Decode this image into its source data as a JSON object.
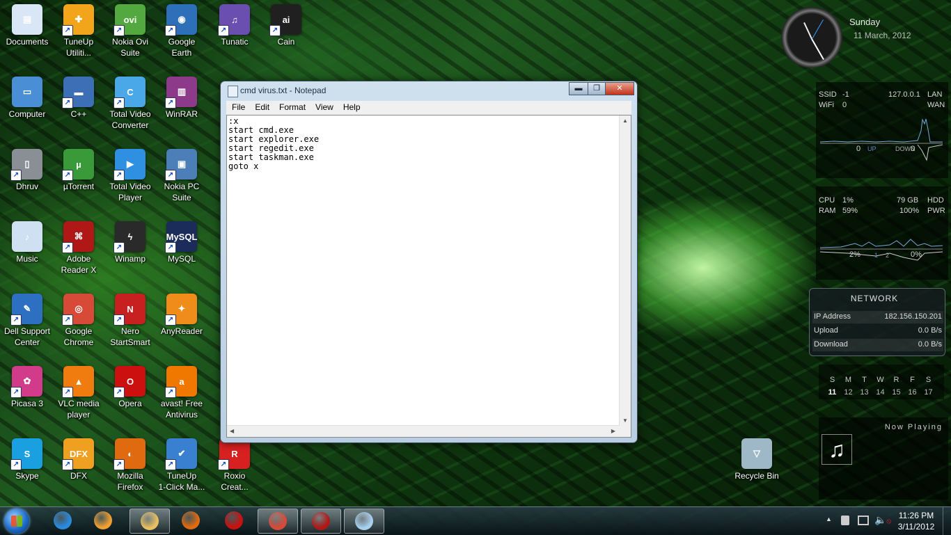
{
  "desktop_icons": [
    {
      "label": "Documents",
      "color": "#d9e6f5",
      "glyph": "▤",
      "shortcut": false
    },
    {
      "label": "TuneUp\nUtiliti...",
      "color": "#f2a51a",
      "glyph": "✚",
      "shortcut": true
    },
    {
      "label": "Nokia Ovi\nSuite",
      "color": "#53a93f",
      "glyph": "ovi",
      "shortcut": true
    },
    {
      "label": "Google\nEarth",
      "color": "#2d6fb8",
      "glyph": "◉",
      "shortcut": true
    },
    {
      "label": "Tunatic",
      "color": "#6a4fb0",
      "glyph": "♫",
      "shortcut": true
    },
    {
      "label": "Cain",
      "color": "#202020",
      "glyph": "ai",
      "shortcut": true
    },
    {
      "label": "Computer",
      "color": "#4a8fd6",
      "glyph": "▭",
      "shortcut": false
    },
    {
      "label": "C++",
      "color": "#3c6fb5",
      "glyph": "▬",
      "shortcut": true
    },
    {
      "label": "Total Video\nConverter",
      "color": "#4aa8e8",
      "glyph": "C",
      "shortcut": true
    },
    {
      "label": "WinRAR",
      "color": "#8e3a8a",
      "glyph": "▥",
      "shortcut": true
    },
    {
      "label": "Dhruv",
      "color": "#8a8f96",
      "glyph": "▯",
      "shortcut": true
    },
    {
      "label": "µTorrent",
      "color": "#3a9a3a",
      "glyph": "µ",
      "shortcut": true
    },
    {
      "label": "Total Video\nPlayer",
      "color": "#2f8fe0",
      "glyph": "▶",
      "shortcut": true
    },
    {
      "label": "Nokia PC\nSuite",
      "color": "#4c7fb8",
      "glyph": "▣",
      "shortcut": true
    },
    {
      "label": "Music",
      "color": "#cfe0f2",
      "glyph": "♪",
      "shortcut": false
    },
    {
      "label": "Adobe\nReader X",
      "color": "#b01818",
      "glyph": "⌘",
      "shortcut": true
    },
    {
      "label": "Winamp",
      "color": "#2a2a2a",
      "glyph": "ϟ",
      "shortcut": true
    },
    {
      "label": "MySQL",
      "color": "#1c2c5a",
      "glyph": "MySQL",
      "shortcut": true
    },
    {
      "label": "Dell Support\nCenter",
      "color": "#2d6fc0",
      "glyph": "✎",
      "shortcut": true
    },
    {
      "label": "Google\nChrome",
      "color": "#d84a38",
      "glyph": "◎",
      "shortcut": true
    },
    {
      "label": "Nero\nStartSmart",
      "color": "#c82020",
      "glyph": "N",
      "shortcut": true
    },
    {
      "label": "AnyReader",
      "color": "#f08c1a",
      "glyph": "✦",
      "shortcut": true
    },
    {
      "label": "Picasa 3",
      "color": "#d23a8a",
      "glyph": "✿",
      "shortcut": true
    },
    {
      "label": "VLC media\nplayer",
      "color": "#f07c10",
      "glyph": "▲",
      "shortcut": true
    },
    {
      "label": "Opera",
      "color": "#cc1010",
      "glyph": "O",
      "shortcut": true
    },
    {
      "label": "avast! Free\nAntivirus",
      "color": "#f07800",
      "glyph": "a",
      "shortcut": true
    },
    {
      "label": "Skype",
      "color": "#1aa0e0",
      "glyph": "S",
      "shortcut": true
    },
    {
      "label": "DFX",
      "color": "#f0a020",
      "glyph": "DFX",
      "shortcut": true
    },
    {
      "label": "Mozilla\nFirefox",
      "color": "#e06a10",
      "glyph": "◐",
      "shortcut": true
    },
    {
      "label": "TuneUp\n1-Click Ma...",
      "color": "#3a80d0",
      "glyph": "✔",
      "shortcut": true
    },
    {
      "label": "Roxio\nCreat...",
      "color": "#d82020",
      "glyph": "R",
      "shortcut": true
    },
    {
      "label": "Recycle Bin",
      "color": "#9fb8c8",
      "glyph": "▽",
      "shortcut": false
    }
  ],
  "notepad": {
    "title": "cmd virus.txt - Notepad",
    "menu": [
      "File",
      "Edit",
      "Format",
      "View",
      "Help"
    ],
    "content": ":x\nstart cmd.exe\nstart explorer.exe\nstart regedit.exe\nstart taskman.exe\ngoto x",
    "minimize": "▬",
    "maximize": "❐",
    "close": "✕"
  },
  "clock_gadget": {
    "day": "Sunday",
    "date": "11 March, 2012"
  },
  "network_meter": {
    "ssid_label": "SSID",
    "ssid_value": "-1",
    "ip": "127.0.0.1",
    "lan": "LAN",
    "wifi_label": "WiFi",
    "wifi_value": "0",
    "wan": "WAN",
    "up_value": "0",
    "up_label": "UP",
    "down_label": "DOWN",
    "down_value": "0"
  },
  "system_meter": {
    "cpu_label": "CPU",
    "cpu_value": "1%",
    "hdd_value": "79 GB",
    "hdd_label": "HDD",
    "ram_label": "RAM",
    "ram_value": "59%",
    "pwr_value": "100%",
    "pwr_label": "PWR",
    "core1": "2%",
    "core1_idx": "1",
    "core2_idx": "2",
    "core2": "0%"
  },
  "network_panel": {
    "heading": "NETWORK",
    "rows": [
      {
        "label": "IP Address",
        "value": "182.156.150.201"
      },
      {
        "label": "Upload",
        "value": "0.0 B/s"
      },
      {
        "label": "Download",
        "value": "0.0 B/s"
      }
    ]
  },
  "calendar": {
    "days": [
      "S",
      "M",
      "T",
      "W",
      "R",
      "F",
      "S"
    ],
    "dates": [
      "11",
      "12",
      "13",
      "14",
      "15",
      "16",
      "17"
    ]
  },
  "now_playing": {
    "heading": "Now Playing"
  },
  "taskbar": {
    "pinned": [
      {
        "name": "internet-explorer-icon",
        "color": "#2a8ae0",
        "active": false
      },
      {
        "name": "media-player-icon",
        "color": "#f0a030",
        "active": false
      },
      {
        "name": "explorer-icon",
        "color": "#e8c060",
        "active": true
      },
      {
        "name": "firefox-icon",
        "color": "#e06a10",
        "active": false
      },
      {
        "name": "opera-icon",
        "color": "#cc1010",
        "active": false
      },
      {
        "name": "chrome-icon",
        "color": "#d84a38",
        "active": true
      },
      {
        "name": "adobe-reader-icon",
        "color": "#b01818",
        "active": true
      },
      {
        "name": "notepad-icon",
        "color": "#a8d0f0",
        "active": true
      }
    ],
    "time": "11:26 PM",
    "date": "3/11/2012"
  },
  "colors": {
    "accent": "#2bd43a",
    "start_orb": "#1e6bc8"
  }
}
